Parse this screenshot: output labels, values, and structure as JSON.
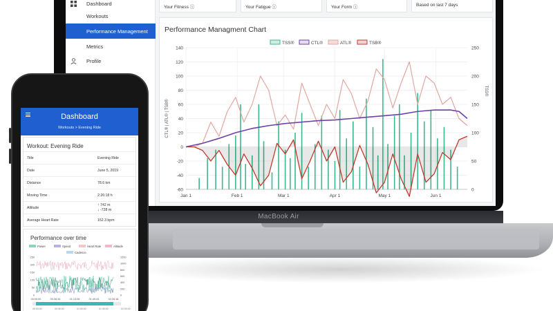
{
  "laptop": {
    "brand_label": "MacBook Air",
    "sidebar": {
      "items": [
        {
          "label": "Dashboard",
          "icon": "dashboard-icon",
          "active": false
        },
        {
          "label": "Workouts",
          "icon": "",
          "active": false
        },
        {
          "label": "Performance Management",
          "icon": "",
          "active": true
        },
        {
          "label": "Metrics",
          "icon": "",
          "active": false
        },
        {
          "label": "Profile",
          "icon": "person-icon",
          "active": false
        }
      ]
    },
    "cards": [
      {
        "label": "Your Fitness ⓘ"
      },
      {
        "label": "Your Fatigue ⓘ"
      },
      {
        "label": "Your Form ⓘ"
      },
      {
        "label": "Based on last 7 days"
      }
    ],
    "chart_title": "Performance Managment Chart"
  },
  "chart_data": {
    "type": "line",
    "title": "Performance Managment Chart",
    "legend": [
      "TSS®",
      "CTL®",
      "ATL®",
      "TSB®"
    ],
    "legend_position": "top",
    "ylabel_left": "CTL® | ATL® | TSB®",
    "ylabel_right": "TSS®",
    "y_left_ticks": [
      "140",
      "120",
      "100",
      "80",
      "60",
      "40",
      "20",
      "0",
      "-20",
      "-40",
      "-60"
    ],
    "y_right_ticks": [
      "250",
      "200",
      "150",
      "100",
      "50",
      "0"
    ],
    "x_ticks": [
      "Jan 1",
      "Feb 1",
      "Mar 1",
      "Apr 1",
      "May 1",
      "Jun 1"
    ],
    "ylim_left": [
      -60,
      140
    ],
    "ylim_right": [
      0,
      250
    ],
    "x_range_days": [
      0,
      170
    ],
    "colors": {
      "tss": "#3cb88e",
      "ctl": "#6e3fa6",
      "atl": "#e2a6a0",
      "tsb": "#c0392b"
    },
    "series": [
      {
        "name": "CTL®",
        "x": [
          0,
          10,
          20,
          30,
          40,
          50,
          60,
          70,
          80,
          90,
          100,
          110,
          120,
          130,
          140,
          150,
          160,
          165,
          170
        ],
        "values": [
          0,
          5,
          12,
          20,
          26,
          30,
          33,
          35,
          37,
          38,
          40,
          42,
          44,
          46,
          50,
          52,
          52,
          50,
          40
        ]
      },
      {
        "name": "ATL®",
        "x": [
          0,
          5,
          10,
          15,
          20,
          25,
          30,
          35,
          40,
          45,
          50,
          55,
          60,
          65,
          70,
          75,
          80,
          85,
          90,
          95,
          100,
          105,
          110,
          115,
          120,
          125,
          130,
          135,
          140,
          145,
          150,
          155,
          160,
          165,
          170
        ],
        "values": [
          0,
          0,
          5,
          35,
          15,
          50,
          70,
          35,
          60,
          100,
          80,
          30,
          45,
          25,
          90,
          60,
          30,
          60,
          40,
          95,
          75,
          40,
          65,
          110,
          95,
          55,
          90,
          120,
          60,
          100,
          90,
          60,
          70,
          40,
          30
        ]
      },
      {
        "name": "TSB®",
        "x": [
          0,
          5,
          10,
          15,
          20,
          25,
          30,
          35,
          40,
          45,
          50,
          55,
          60,
          65,
          70,
          75,
          80,
          85,
          90,
          95,
          100,
          105,
          110,
          115,
          120,
          125,
          130,
          135,
          140,
          145,
          150,
          155,
          160,
          165,
          170
        ],
        "values": [
          0,
          0,
          -5,
          -20,
          -5,
          -25,
          -40,
          -10,
          -30,
          -55,
          -40,
          5,
          -10,
          10,
          -45,
          -20,
          8,
          -20,
          0,
          -50,
          -35,
          2,
          -25,
          -65,
          -50,
          -10,
          -45,
          -70,
          -10,
          -50,
          -38,
          -8,
          -18,
          10,
          15
        ]
      },
      {
        "name": "TSS®",
        "x": [
          8,
          13,
          18,
          22,
          26,
          30,
          33,
          36,
          40,
          44,
          47,
          52,
          56,
          60,
          63,
          66,
          70,
          74,
          78,
          82,
          86,
          90,
          93,
          97,
          101,
          105,
          109,
          113,
          116,
          119,
          122,
          126,
          129,
          132,
          136,
          140,
          144,
          148,
          152,
          156,
          160,
          164
        ],
        "values": [
          20,
          55,
          70,
          40,
          80,
          95,
          150,
          45,
          60,
          150,
          85,
          30,
          120,
          70,
          55,
          100,
          135,
          40,
          80,
          130,
          70,
          50,
          140,
          90,
          120,
          40,
          160,
          110,
          60,
          230,
          80,
          130,
          150,
          60,
          100,
          170,
          120,
          140,
          90,
          110,
          70,
          40
        ]
      }
    ]
  },
  "phone": {
    "header_title": "Dashboard",
    "breadcrumb": "Workouts   >   Evening Ride",
    "workout_title": "Workout: Evening Ride",
    "rows": [
      {
        "label": "Title",
        "value": "Evening Ride"
      },
      {
        "label": "Date",
        "value": "June 5, 2019"
      },
      {
        "label": "Distance",
        "value": "78.6 km"
      },
      {
        "label": "Moving Time",
        "value": "2:26:18 h"
      },
      {
        "label": "Altitude",
        "value": "↑ 742 m",
        "value2": "↓ -728 m"
      },
      {
        "label": "Average Heart Rate",
        "value": "152.3 bpm"
      }
    ],
    "chart_title": "Performance over time",
    "legend": [
      "Power",
      "Speed",
      "Heart Rate",
      "Altitude",
      "Cadence"
    ],
    "left_ticks": [
      "250",
      "200",
      "150",
      "100",
      "50",
      "0"
    ],
    "right_ticks": [
      "1200",
      "1000",
      "800",
      "600",
      "400",
      "200",
      "0"
    ],
    "time_ticks": [
      "00:00:00",
      "00:36:34",
      "01:13:08",
      "01:49:43",
      "02:26:18"
    ],
    "slider_ticks": [
      "00:00:00",
      "00:30:00",
      "01:00:00",
      "01:30:00",
      "02:00:00"
    ]
  }
}
